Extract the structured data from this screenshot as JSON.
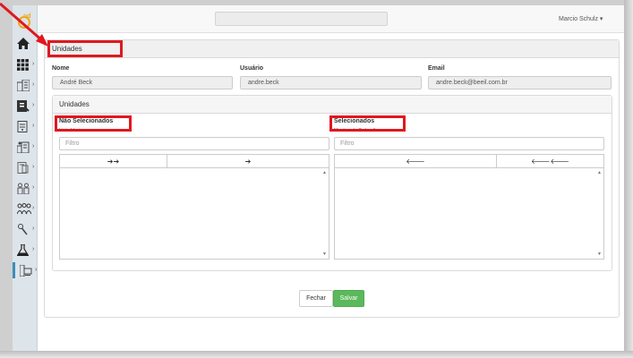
{
  "app": {
    "logo_text": "od"
  },
  "header": {
    "user_name": "Marcio Schulz",
    "user_caret": "▾"
  },
  "panel": {
    "title": "Unidades",
    "fields": [
      {
        "label": "Nome",
        "value": "André Beck"
      },
      {
        "label": "Usuário",
        "value": "andre.beck"
      },
      {
        "label": "Email",
        "value": "andre.beck@beeil.com.br"
      }
    ]
  },
  "unidades": {
    "title": "Unidades",
    "left": {
      "title": "Não Selecionados",
      "status": "Lista Vazia",
      "filter_placeholder": "Filtro",
      "btn_move_all": "➔➔",
      "btn_move": "➔"
    },
    "right": {
      "title": "Selecionados",
      "status": "Mostrando Todos 1",
      "filter_placeholder": "Filtro",
      "btn_remove": "🡐",
      "btn_remove_all": "🡐🡐"
    }
  },
  "actions": {
    "close_label": "Fechar",
    "save_label": "Salvar"
  },
  "colors": {
    "accent": "#3c8dbc",
    "save": "#5cb85c",
    "highlight": "#e0181f",
    "logo": "#f0a81a"
  }
}
